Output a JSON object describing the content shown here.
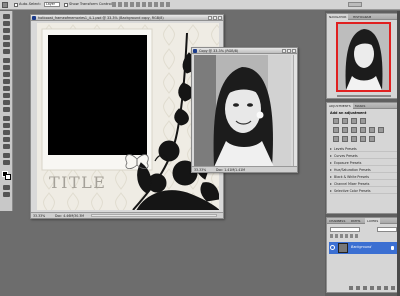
{
  "options_bar": {
    "auto_select_label": "Auto-Select:",
    "auto_select_value": "Layer",
    "show_transform_label": "Show Transform Controls"
  },
  "doc_main": {
    "title": "hotboost_frameofmemories1_4-1.psd @ 33.3% (Background copy, RGB/8)",
    "zoom": "33.33%",
    "status": "Doc: 4.46M/30.3M",
    "title_text": "TITLE"
  },
  "doc_photo": {
    "title": "Copy @ 33.3% (RGB/8)",
    "zoom": "33.33%",
    "status": "Doc: 1.41M/1.41M"
  },
  "navigator": {
    "tabs": [
      "NAVIGATOR",
      "HISTOGRAM"
    ]
  },
  "adjustments": {
    "tabs": [
      "ADJUSTMENTS",
      "MASKS"
    ],
    "header": "Add an adjustment",
    "presets": [
      "Levels Presets",
      "Curves Presets",
      "Exposure Presets",
      "Hue/Saturation Presets",
      "Black & White Presets",
      "Channel Mixer Presets",
      "Selective Color Presets"
    ]
  },
  "layers": {
    "tabs": [
      "CHANNELS",
      "PATHS",
      "LAYERS"
    ],
    "layer_name": "Background"
  },
  "colors": {
    "workspace": "#6d6d6d",
    "panel": "#d6d6d6",
    "accent": "#1b3b8a"
  }
}
